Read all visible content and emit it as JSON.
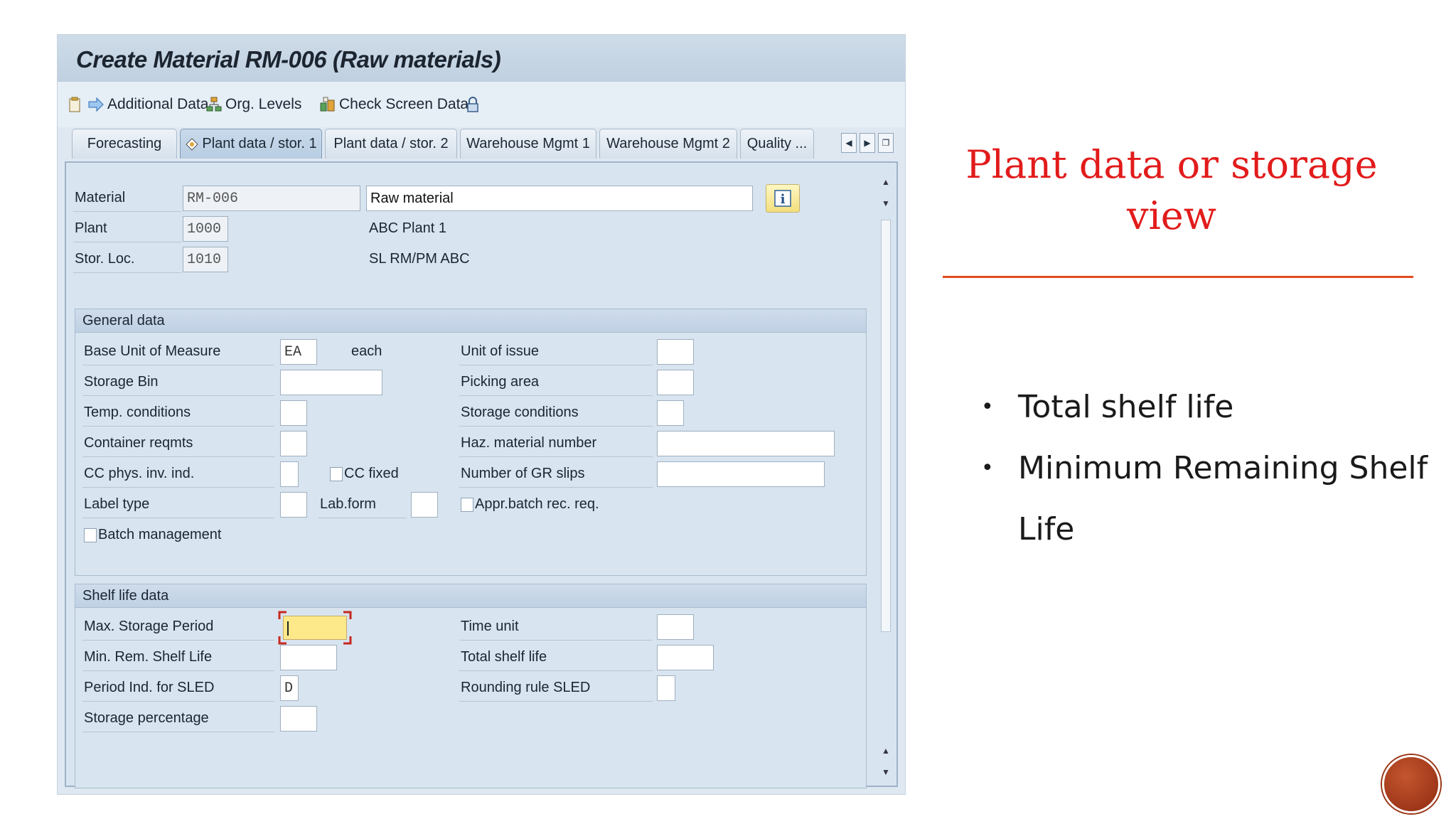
{
  "window": {
    "title": "Create Material RM-006 (Raw materials)"
  },
  "toolbar": {
    "additional_data": "Additional Data",
    "org_levels": "Org. Levels",
    "check_screen_data": "Check Screen Data"
  },
  "tabs": [
    {
      "label": "Forecasting",
      "active": false
    },
    {
      "label": "Plant data / stor. 1",
      "active": true
    },
    {
      "label": "Plant data / stor. 2",
      "active": false
    },
    {
      "label": "Warehouse Mgmt 1",
      "active": false
    },
    {
      "label": "Warehouse Mgmt 2",
      "active": false
    },
    {
      "label": "Quality ...",
      "active": false
    }
  ],
  "header": {
    "material_label": "Material",
    "material_value": "RM-006",
    "material_desc": "Raw material",
    "plant_label": "Plant",
    "plant_value": "1000",
    "plant_desc": "ABC Plant 1",
    "storloc_label": "Stor. Loc.",
    "storloc_value": "1010",
    "storloc_desc": "SL RM/PM ABC"
  },
  "general": {
    "title": "General data",
    "base_uom_label": "Base Unit of Measure",
    "base_uom_value": "EA",
    "base_uom_text": "each",
    "unit_issue_label": "Unit of issue",
    "storage_bin_label": "Storage Bin",
    "picking_area_label": "Picking area",
    "temp_cond_label": "Temp. conditions",
    "storage_cond_label": "Storage conditions",
    "container_label": "Container reqmts",
    "haz_label": "Haz. material number",
    "cc_phys_label": "CC phys. inv. ind.",
    "cc_fixed_label": "CC fixed",
    "gr_slips_label": "Number of GR slips",
    "label_type_label": "Label type",
    "lab_form_label": "Lab.form",
    "appr_batch_label": "Appr.batch rec. req.",
    "batch_mgmt_label": "Batch management"
  },
  "shelf": {
    "title": "Shelf life data",
    "max_storage_label": "Max. Storage Period",
    "time_unit_label": "Time unit",
    "min_rem_label": "Min. Rem. Shelf Life",
    "total_shelf_label": "Total shelf life",
    "period_ind_label": "Period Ind. for SLED",
    "period_ind_value": "D",
    "rounding_label": "Rounding rule SLED",
    "storage_pct_label": "Storage percentage"
  },
  "slide": {
    "title": "Plant data or storage view",
    "bullets": [
      "Total shelf life",
      "Minimum Remaining Shelf Life"
    ]
  },
  "colors": {
    "title_red": "#e21b1b",
    "divider": "#e24a20",
    "sap_background": "#d8e4ef",
    "active_field": "#fde98a"
  }
}
